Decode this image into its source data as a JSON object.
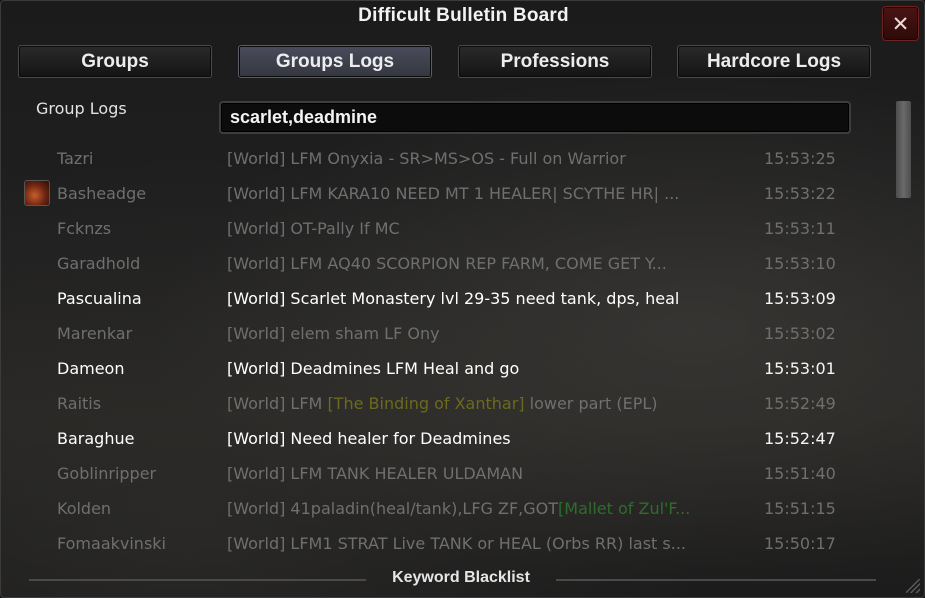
{
  "window": {
    "title": "Difficult Bulletin Board",
    "close_label": "✕"
  },
  "tabs": [
    {
      "label": "Groups",
      "active": false
    },
    {
      "label": "Groups Logs",
      "active": true
    },
    {
      "label": "Professions",
      "active": false
    },
    {
      "label": "Hardcore Logs",
      "active": false
    }
  ],
  "group_logs": {
    "label": "Group Logs",
    "search_value": "scarlet,deadmine",
    "rows": [
      {
        "name": "Tazri",
        "message": "[World] LFM Onyxia - SR>MS>OS - Full on Warrior",
        "time": "15:53:25",
        "highlight": false
      },
      {
        "name": "Basheadge",
        "message": "[World] LFM KARA10 NEED MT 1 HEALER| SCYTHE HR| ...",
        "time": "15:53:22",
        "highlight": false,
        "icon": "class-icon"
      },
      {
        "name": "Fcknzs",
        "message": "[World] OT-Pally If MC",
        "time": "15:53:11",
        "highlight": false
      },
      {
        "name": "Garadhold",
        "message": "[World] LFM AQ40 SCORPION REP FARM, COME GET Y...",
        "time": "15:53:10",
        "highlight": false
      },
      {
        "name": "Pascualina",
        "message": "[World] Scarlet Monastery lvl 29-35 need tank, dps, heal",
        "time": "15:53:09",
        "highlight": true
      },
      {
        "name": "Marenkar",
        "message": "[World] elem sham LF Ony",
        "time": "15:53:02",
        "highlight": false
      },
      {
        "name": "Dameon",
        "message": "[World] Deadmines LFM Heal and go",
        "time": "15:53:01",
        "highlight": true
      },
      {
        "name": "Raitis",
        "message_pre": "[World] LFM ",
        "message_link": "[The Binding of Xanthar]",
        "message_post": " lower part (EPL)",
        "time": "15:52:49",
        "highlight": false
      },
      {
        "name": "Baraghue",
        "message": "[World] Need healer for Deadmines",
        "time": "15:52:47",
        "highlight": true
      },
      {
        "name": "Goblinripper",
        "message": "[World] LFM TANK HEALER ULDAMAN",
        "time": "15:51:40",
        "highlight": false
      },
      {
        "name": "Kolden",
        "message_pre": "[World] 41paladin(heal/tank),LFG ZF,GOT",
        "message_link": "[Mallet of Zul'F...",
        "message_post": "",
        "time": "15:51:15",
        "highlight": false
      },
      {
        "name": "Fomaakvinski",
        "message": "[World] LFM1 STRAT Live TANK or HEAL (Orbs RR) last s...",
        "time": "15:50:17",
        "highlight": false
      }
    ]
  },
  "footer": {
    "blacklist_label": "Keyword Blacklist"
  },
  "colors": {
    "highlight_text": "#ffffff",
    "dim_text": "#6f6f6f",
    "item_link_yellow": "#6b6a1e",
    "item_link_green": "#2e6d2a",
    "active_tab": "#4a4c5c"
  }
}
